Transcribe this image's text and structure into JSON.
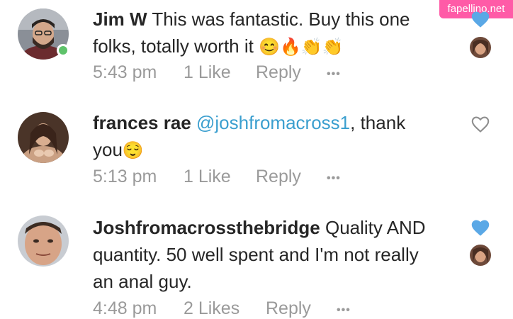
{
  "watermark": "fapellino.net",
  "colors": {
    "mention": "#3b9fcf",
    "heart_liked": "#5aa8e6",
    "meta_gray": "#9a9a9a",
    "online": "#5ec26a"
  },
  "comments": [
    {
      "username": "Jim W",
      "text": "This was fantastic. Buy this one folks, totally worth it",
      "emojis": "😊🔥👏👏",
      "time": "5:43 pm",
      "likes": "1 Like",
      "reply": "Reply",
      "more": "•••",
      "liked": true,
      "icons": [
        "heart-filled-icon",
        "liker-avatar"
      ]
    },
    {
      "username": "frances rae",
      "mention": "@joshfromacross1",
      "text_after": ", thank you",
      "emojis": "😌",
      "time": "5:13 pm",
      "likes": "1 Like",
      "reply": "Reply",
      "more": "•••",
      "liked": false,
      "icons": [
        "heart-outline-icon"
      ]
    },
    {
      "username": "Joshfromacrossthebridge",
      "text": "Quality AND quantity. 50 well spent and I'm not really an anal guy.",
      "time": "4:48 pm",
      "likes": "2 Likes",
      "reply": "Reply",
      "more": "•••",
      "liked": true,
      "icons": [
        "heart-filled-icon",
        "liker-avatar"
      ]
    }
  ]
}
